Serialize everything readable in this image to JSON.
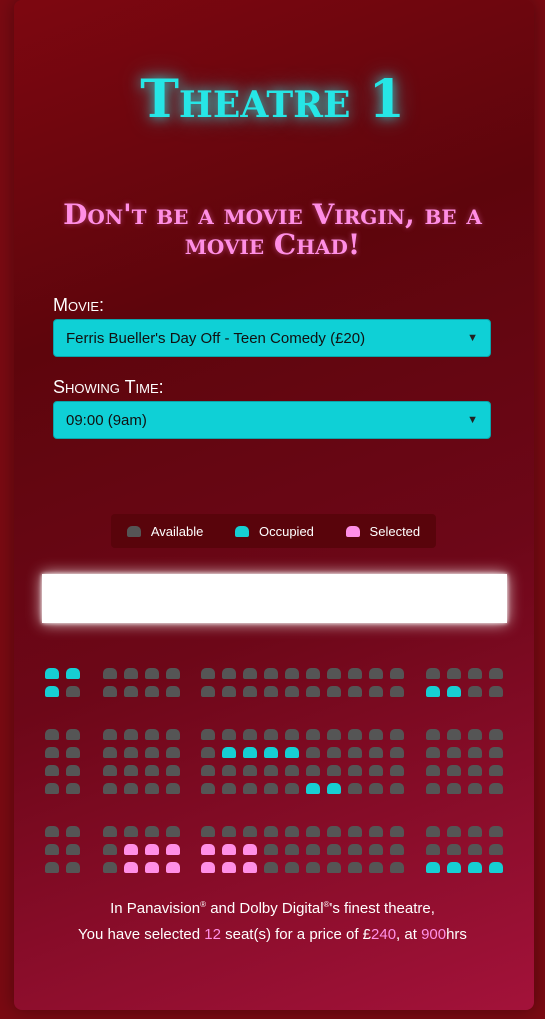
{
  "title": "Theatre 1",
  "tagline": "Don't be a movie Virgin, be a movie Chad!",
  "movie_label": "Movie:",
  "movie_value": "Ferris Bueller's Day Off - Teen Comedy (£20)",
  "time_label": "Showing Time:",
  "time_value": "09:00 (9am)",
  "legend": {
    "available": "Available",
    "occupied": "Occupied",
    "selected": "Selected"
  },
  "colors": {
    "available": "#555555",
    "occupied": "#16cfd3",
    "selected": "#ff8fe6"
  },
  "info": {
    "line1_prefix": "In Panavision",
    "reg1": "®",
    "line1_mid": " and Dolby Digital",
    "reg2": "®",
    "line1_suffix": "'s finest theatre,",
    "line2_a": "You have selected ",
    "seat_count": "12",
    "line2_b": " seat(s) for a price of £",
    "price": "240",
    "line2_c": ", at ",
    "time": "900",
    "line2_d": "hrs"
  },
  "seat_rows": [
    "OO AAAA AAAAAAAAAA AAAA",
    "OA AAAA AAAAAAAAAA OOAA",
    "AA AAAA AAAAAAAAAA AAAA",
    "AA AAAA AOOOOAAAAA AAAA",
    "AA AAAA AAAAAAAAAA AAAA",
    "AA AAAA AAAAAOOAAA AAAA",
    "AA AAAA AAAAAAAAAA AAAA",
    "AA ASSS SSSAAAAAAA AAAA",
    "AA ASSS SSSAAAAAAA OOOO"
  ]
}
